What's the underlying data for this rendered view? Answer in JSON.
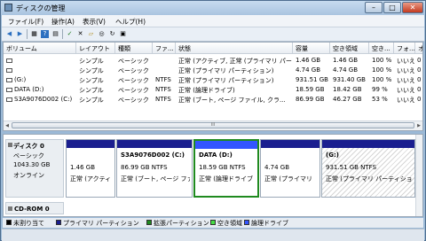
{
  "window": {
    "title": "ディスクの管理",
    "min": "–",
    "max": "□",
    "close": "✕"
  },
  "menu": [
    "ファイル(F)",
    "操作(A)",
    "表示(V)",
    "ヘルプ(H)"
  ],
  "toolbar": {
    "icons": [
      "back-icon",
      "forward-icon",
      "list-view-icon",
      "help-icon",
      "properties-icon",
      "check-icon",
      "delete-icon",
      "folder-icon",
      "search-icon",
      "refresh-icon",
      "settings-icon"
    ],
    "glyphs": [
      "◀",
      "▶",
      "▦",
      "?",
      "▤",
      "✓",
      "✕",
      "▱",
      "◎",
      "↻",
      "▣"
    ]
  },
  "volumes": {
    "columns": [
      "ボリューム",
      "レイアウト",
      "種類",
      "ファ...",
      "状態",
      "容量",
      "空き領域",
      "空き...",
      "フォ...",
      "オ"
    ],
    "rows": [
      [
        "",
        "シンプル",
        "ベーシック",
        "",
        "正常 (アクティブ, 正常 (プライマリ パーティション)",
        "1.46 GB",
        "1.46 GB",
        "100 %",
        "いいえ",
        "0"
      ],
      [
        "",
        "シンプル",
        "ベーシック",
        "",
        "正常 (プライマリ パーティション)",
        "4.74 GB",
        "4.74 GB",
        "100 %",
        "いいえ",
        "0"
      ],
      [
        "(G:)",
        "シンプル",
        "ベーシック",
        "NTFS",
        "正常 (プライマリ パーティション)",
        "931.51 GB",
        "931.40 GB",
        "100 %",
        "いいえ",
        "0"
      ],
      [
        "DATA (D:)",
        "シンプル",
        "ベーシック",
        "NTFS",
        "正常 (論理ドライブ)",
        "18.59 GB",
        "18.42 GB",
        "99 %",
        "いいえ",
        "0"
      ],
      [
        "S3A9076D002 (C:)",
        "シンプル",
        "ベーシック",
        "NTFS",
        "正常 (ブート, ページ ファイル, クラ...",
        "86.99 GB",
        "46.27 GB",
        "53 %",
        "いいえ",
        "0"
      ]
    ],
    "scroll_mark": "III"
  },
  "disk0": {
    "name": "ディスク 0",
    "type": "ベーシック",
    "size": "1043.30 GB",
    "status": "オンライン",
    "partitions": [
      {
        "title": "",
        "size": "1.46 GB",
        "status": "正常 (アクティ"
      },
      {
        "title": "S3A9076D002 (C:)",
        "size": "86.99 GB NTFS",
        "status": "正常 (ブート, ページ ファ"
      },
      {
        "title": "DATA (D:)",
        "size": "18.59 GB NTFS",
        "status": "正常 (論理ドライブ"
      },
      {
        "title": "",
        "size": "4.74 GB",
        "status": "正常 (プライマリ"
      },
      {
        "title": "(G:)",
        "size": "931.51 GB NTFS",
        "status": "正常 (プライマリ パーティショ"
      }
    ]
  },
  "cdrom": {
    "name": "CD-ROM 0"
  },
  "legend": [
    {
      "label": "未割り当て",
      "color": "#000000"
    },
    {
      "label": "プライマリ パーティション",
      "color": "#1a1e8f"
    },
    {
      "label": "拡張パーティション",
      "color": "#1f8a1f"
    },
    {
      "label": "空き領域",
      "color": "#44dd44"
    },
    {
      "label": "論理ドライブ",
      "color": "#3355ff"
    }
  ]
}
